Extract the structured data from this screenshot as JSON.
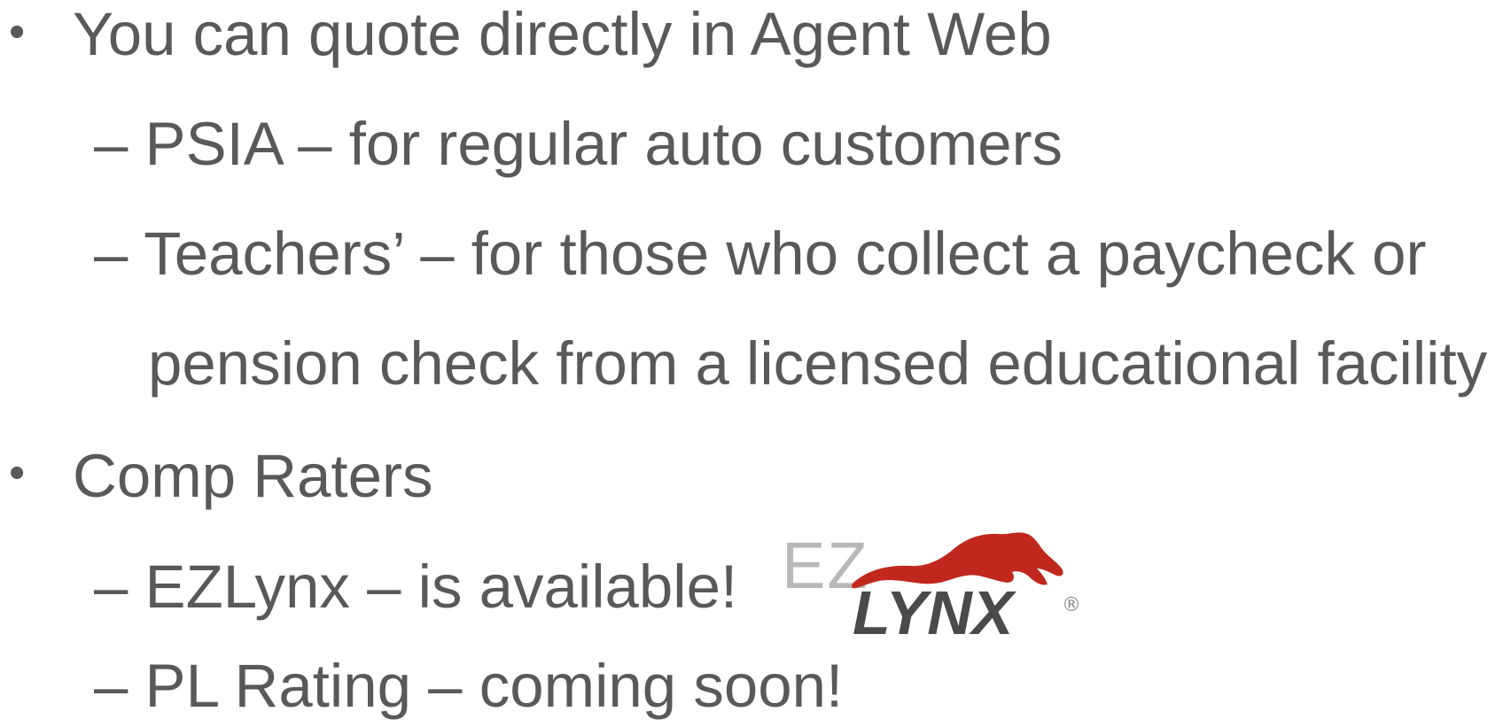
{
  "bullets": [
    {
      "marker": "•",
      "text": "You can quote directly in Agent Web",
      "subitems": [
        {
          "text": "– PSIA – for regular auto customers"
        },
        {
          "text": "– Teachers’ – for those who collect a paycheck or"
        },
        {
          "text": "pension check from a licensed educational facility"
        }
      ]
    },
    {
      "marker": "•",
      "text": "Comp Raters",
      "subitems": [
        {
          "text": "– EZLynx – is available!"
        },
        {
          "text": "– PL Rating – coming soon!"
        }
      ]
    }
  ],
  "logo": {
    "icon": "ezlynx-logo",
    "prefix": "EZ",
    "name": "LYNX",
    "registered": "®",
    "colors": {
      "prefix": "#b8b8b8",
      "name": "#4a4a4a",
      "cat": "#c0281e"
    }
  }
}
